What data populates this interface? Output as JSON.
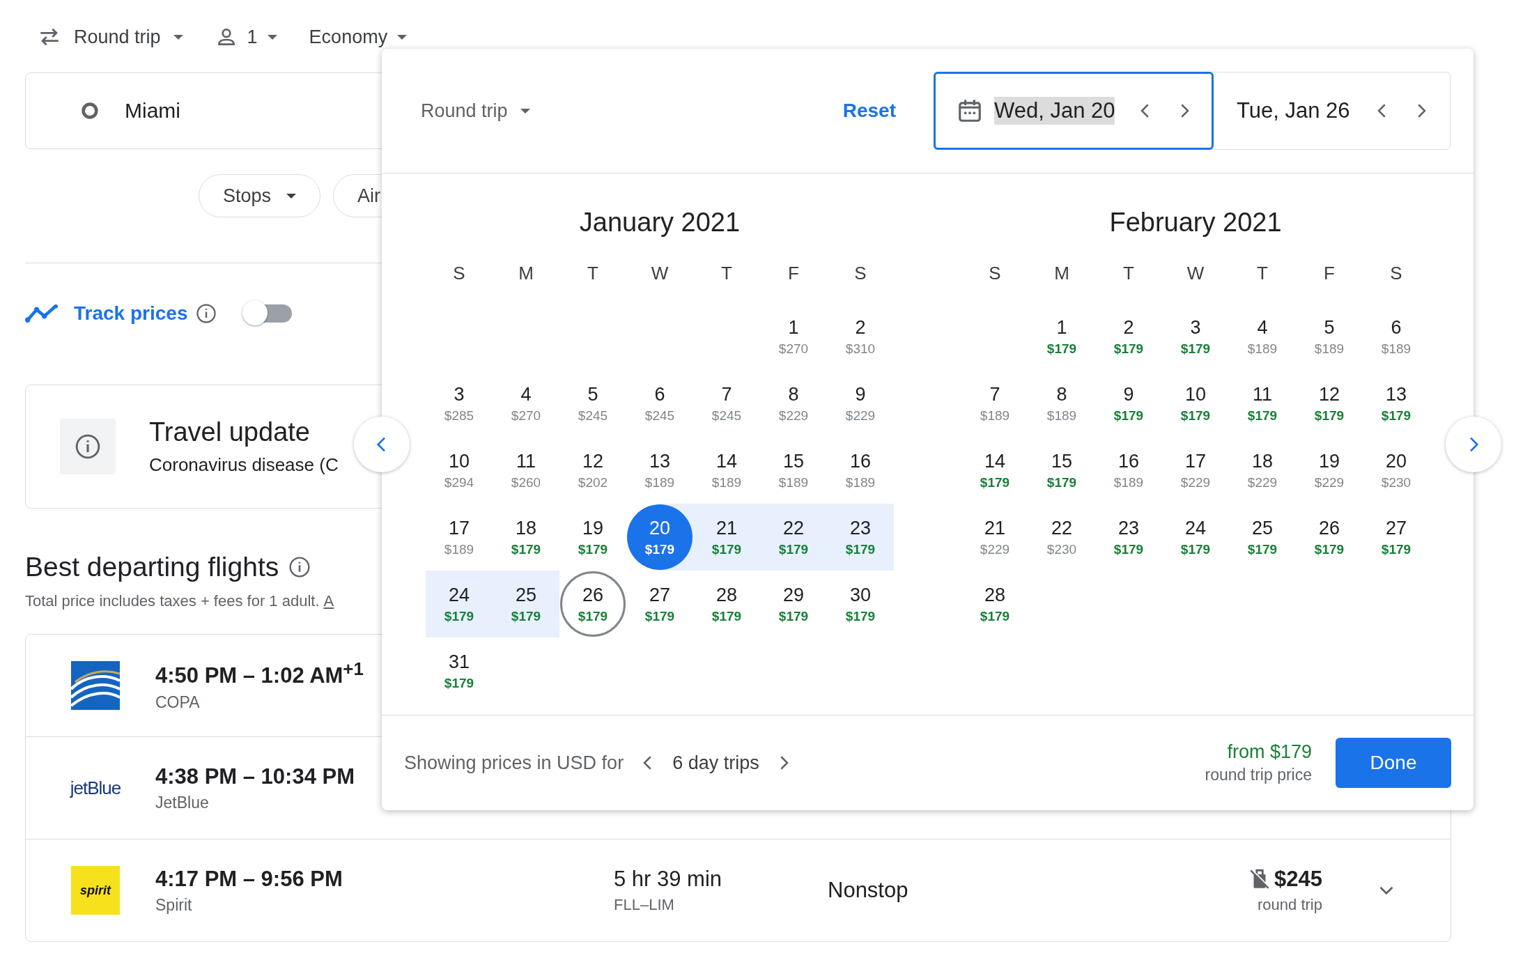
{
  "top_bar": {
    "trip_type": "Round trip",
    "passengers": "1",
    "cabin": "Economy"
  },
  "search": {
    "origin": "Miami"
  },
  "filters": [
    {
      "label": "Stops"
    },
    {
      "label": "Air"
    }
  ],
  "track_prices": {
    "label": "Track prices",
    "on": false
  },
  "travel_update": {
    "title": "Travel update",
    "text": "Coronavirus disease (C"
  },
  "section": {
    "title": "Best departing flights",
    "note": "Total price includes taxes + fees for 1 adult.",
    "link": "A"
  },
  "flights": [
    {
      "times": "4:50 PM – 1:02 AM$^{+1}$",
      "airline": "COPA",
      "kind": "emblem"
    },
    {
      "times": "4:38 PM – 10:34 PM",
      "airline": "JetBlue",
      "kind": "wordmark",
      "logo_text": "jetBlue"
    },
    {
      "times": "4:17 PM – 9:56 PM",
      "airline": "Spirit",
      "kind": "badge",
      "logo_text": "spirit",
      "duration": "5 hr 39 min",
      "route": "FLL–LIM",
      "stops": "Nonstop",
      "price": "$245",
      "price_note": "round trip",
      "no_carry_on": true
    }
  ],
  "date_picker": {
    "trip_type": "Round trip",
    "reset": "Reset",
    "fields": [
      {
        "value": "Wed, Jan 20",
        "selected": true
      },
      {
        "value": "Tue, Jan 26",
        "selected": false
      }
    ],
    "months": [
      {
        "title": "January 2021",
        "weekdays": [
          "S",
          "M",
          "T",
          "W",
          "T",
          "F",
          "S"
        ],
        "weeks": [
          [
            {
              "day": "1",
              "price": "$270",
              "cheap": false,
              "selected": false,
              "in_range": false
            },
            {
              "day": "2",
              "price": "$310",
              "cheap": false,
              "selected": false,
              "in_range": false
            }
          ],
          [
            {
              "day": "3",
              "price": "$285",
              "cheap": false,
              "selected": false,
              "in_range": false
            },
            {
              "day": "4",
              "price": "$270",
              "cheap": false,
              "selected": false,
              "in_range": false
            },
            {
              "day": "5",
              "price": "$245",
              "cheap": false,
              "selected": false,
              "in_range": false
            },
            {
              "day": "6",
              "price": "$245",
              "cheap": false,
              "selected": false,
              "in_range": false
            },
            {
              "day": "7",
              "price": "$245",
              "cheap": false,
              "selected": false,
              "in_range": false
            },
            {
              "day": "8",
              "price": "$229",
              "cheap": false,
              "selected": false,
              "in_range": false
            },
            {
              "day": "9",
              "price": "$229",
              "cheap": false,
              "selected": false,
              "in_range": false
            }
          ],
          [
            {
              "day": "10",
              "price": "$294",
              "cheap": false,
              "selected": false,
              "in_range": false
            },
            {
              "day": "11",
              "price": "$260",
              "cheap": false,
              "selected": false,
              "in_range": false
            },
            {
              "day": "12",
              "price": "$202",
              "cheap": false,
              "selected": false,
              "in_range": false
            },
            {
              "day": "13",
              "price": "$189",
              "cheap": false,
              "selected": false,
              "in_range": false
            },
            {
              "day": "14",
              "price": "$189",
              "cheap": false,
              "selected": false,
              "in_range": false
            },
            {
              "day": "15",
              "price": "$189",
              "cheap": false,
              "selected": false,
              "in_range": false
            },
            {
              "day": "16",
              "price": "$189",
              "cheap": false,
              "selected": false,
              "in_range": false
            }
          ],
          [
            {
              "day": "17",
              "price": "$189",
              "cheap": false,
              "selected": false,
              "in_range": false
            },
            {
              "day": "18",
              "price": "$179",
              "cheap": true,
              "selected": false,
              "in_range": false
            },
            {
              "day": "19",
              "price": "$179",
              "cheap": true,
              "selected": false,
              "in_range": false
            },
            {
              "day": "20",
              "price": "$179",
              "cheap": true,
              "selected": true,
              "in_range": false
            },
            {
              "day": "21",
              "price": "$179",
              "cheap": true,
              "selected": false,
              "in_range": true
            },
            {
              "day": "22",
              "price": "$179",
              "cheap": true,
              "selected": false,
              "in_range": true
            },
            {
              "day": "23",
              "price": "$179",
              "cheap": true,
              "selected": false,
              "in_range": true
            }
          ],
          [
            {
              "day": "24",
              "price": "$179",
              "cheap": true,
              "selected": false,
              "in_range": true
            },
            {
              "day": "25",
              "price": "$179",
              "cheap": true,
              "selected": false,
              "in_range": true
            },
            {
              "day": "26",
              "price": "$179",
              "cheap": true,
              "selected": true,
              "in_range": false
            },
            {
              "day": "27",
              "price": "$179",
              "cheap": true,
              "selected": false,
              "in_range": false
            },
            {
              "day": "28",
              "price": "$179",
              "cheap": true,
              "selected": false,
              "in_range": false
            },
            {
              "day": "29",
              "price": "$179",
              "cheap": true,
              "selected": false,
              "in_range": false
            },
            {
              "day": "30",
              "price": "$179",
              "cheap": true,
              "selected": false,
              "in_range": false
            }
          ],
          [
            {
              "day": "31",
              "price": "$179",
              "cheap": true,
              "selected": false,
              "in_range": false
            }
          ]
        ]
      },
      {
        "title": "February 2021",
        "weekdays": [
          "S",
          "M",
          "T",
          "W",
          "T",
          "F",
          "S"
        ],
        "weeks": [
          [
            {
              "day": "1",
              "price": "$179",
              "cheap": true,
              "selected": false,
              "in_range": false
            },
            {
              "day": "2",
              "price": "$179",
              "cheap": true,
              "selected": false,
              "in_range": false
            },
            {
              "day": "3",
              "price": "$179",
              "cheap": true,
              "selected": false,
              "in_range": false
            },
            {
              "day": "4",
              "price": "$189",
              "cheap": false,
              "selected": false,
              "in_range": false
            },
            {
              "day": "5",
              "price": "$189",
              "cheap": false,
              "selected": false,
              "in_range": false
            },
            {
              "day": "6",
              "price": "$189",
              "cheap": false,
              "selected": false,
              "in_range": false
            }
          ],
          [
            {
              "day": "7",
              "price": "$189",
              "cheap": false,
              "selected": false,
              "in_range": false
            },
            {
              "day": "8",
              "price": "$189",
              "cheap": false,
              "selected": false,
              "in_range": false
            },
            {
              "day": "9",
              "price": "$179",
              "cheap": true,
              "selected": false,
              "in_range": false
            },
            {
              "day": "10",
              "price": "$179",
              "cheap": true,
              "selected": false,
              "in_range": false
            },
            {
              "day": "11",
              "price": "$179",
              "cheap": true,
              "selected": false,
              "in_range": false
            },
            {
              "day": "12",
              "price": "$179",
              "cheap": true,
              "selected": false,
              "in_range": false
            },
            {
              "day": "13",
              "price": "$179",
              "cheap": true,
              "selected": false,
              "in_range": false
            }
          ],
          [
            {
              "day": "14",
              "price": "$179",
              "cheap": true,
              "selected": false,
              "in_range": false
            },
            {
              "day": "15",
              "price": "$179",
              "cheap": true,
              "selected": false,
              "in_range": false
            },
            {
              "day": "16",
              "price": "$189",
              "cheap": false,
              "selected": false,
              "in_range": false
            },
            {
              "day": "17",
              "price": "$229",
              "cheap": false,
              "selected": false,
              "in_range": false
            },
            {
              "day": "18",
              "price": "$229",
              "cheap": false,
              "selected": false,
              "in_range": false
            },
            {
              "day": "19",
              "price": "$229",
              "cheap": false,
              "selected": false,
              "in_range": false
            },
            {
              "day": "20",
              "price": "$230",
              "cheap": false,
              "selected": false,
              "in_range": false
            }
          ],
          [
            {
              "day": "21",
              "price": "$229",
              "cheap": false,
              "selected": false,
              "in_range": false
            },
            {
              "day": "22",
              "price": "$230",
              "cheap": false,
              "selected": false,
              "in_range": false
            },
            {
              "day": "23",
              "price": "$179",
              "cheap": true,
              "selected": false,
              "in_range": false
            },
            {
              "day": "24",
              "price": "$179",
              "cheap": true,
              "selected": false,
              "in_range": false
            },
            {
              "day": "25",
              "price": "$179",
              "cheap": true,
              "selected": false,
              "in_range": false
            },
            {
              "day": "26",
              "price": "$179",
              "cheap": true,
              "selected": false,
              "in_range": false
            },
            {
              "day": "27",
              "price": "$179",
              "cheap": true,
              "selected": false,
              "in_range": false
            }
          ],
          [
            {
              "day": "28",
              "price": "$179",
              "cheap": true,
              "selected": false,
              "in_range": false
            }
          ]
        ]
      }
    ],
    "footer": {
      "text": "Showing prices in USD for",
      "trip_length": "6 day trips",
      "from_price": "from $179",
      "price_note": "round trip price",
      "done": "Done"
    }
  }
}
